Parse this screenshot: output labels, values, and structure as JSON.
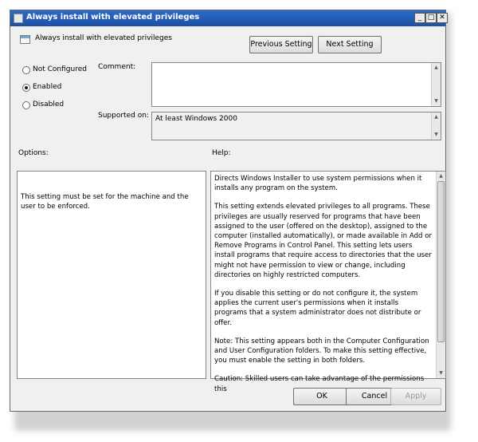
{
  "window": {
    "title": "Always install with elevated privileges",
    "minimize_glyph": "_",
    "maximize_glyph": "□",
    "close_glyph": "✕"
  },
  "header": {
    "setting_name": "Always install with elevated privileges",
    "previous_label": "Previous Setting",
    "next_label": "Next Setting"
  },
  "state": {
    "options": [
      {
        "label": "Not Configured",
        "selected": false
      },
      {
        "label": "Enabled",
        "selected": true
      },
      {
        "label": "Disabled",
        "selected": false
      }
    ]
  },
  "comment": {
    "label": "Comment:",
    "value": ""
  },
  "supported": {
    "label": "Supported on:",
    "value": "At least Windows 2000"
  },
  "options_panel": {
    "label": "Options:",
    "text": "This setting must be set for the machine and the user to be enforced."
  },
  "help_panel": {
    "label": "Help:",
    "paragraphs": [
      "Directs Windows Installer to use system permissions when it installs any program on the system.",
      "This setting extends elevated privileges to all programs. These privileges are usually reserved for programs that have been assigned to the user (offered on the desktop), assigned to the computer (installed automatically), or made available in Add or Remove Programs in Control Panel. This setting lets users install programs that require access to directories that the user might not have permission to view or change, including directories on highly restricted computers.",
      "If you disable this setting or do not configure it, the system applies the current user's permissions when it installs programs that a system administrator does not distribute or offer.",
      "Note: This setting appears both in the Computer Configuration and User Configuration folders. To make this setting effective, you must enable the setting in both folders.",
      "Caution: Skilled users can take advantage of the permissions this"
    ]
  },
  "footer": {
    "ok_label": "OK",
    "cancel_label": "Cancel",
    "apply_label": "Apply"
  }
}
